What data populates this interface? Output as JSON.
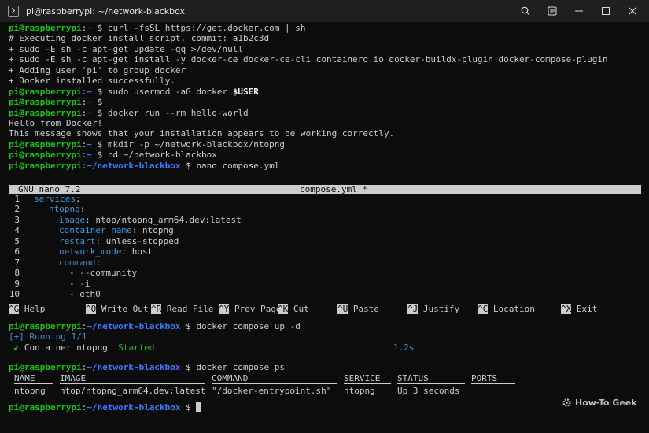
{
  "window": {
    "title": "pi@raspberrypi: ~/network-blackbox",
    "icons": [
      "terminal-icon",
      "search-icon",
      "tab-menu-icon",
      "minimize-icon",
      "maximize-icon",
      "close-icon"
    ]
  },
  "prompt": {
    "user": "pi@raspberrypi",
    "sep": ":",
    "home": "~",
    "project_path": "~/network-blackbox",
    "dollar": " $ "
  },
  "lines": {
    "l1_cmd": "curl -fsSL https://get.docker.com | sh",
    "l2": "# Executing docker install script, commit: a1b2c3d",
    "l3": "+ sudo -E sh -c apt-get update -qq >/dev/null",
    "l4": "+ sudo -E sh -c apt-get install -y docker-ce docker-ce-cli containerd.io docker-buildx-plugin docker-compose-plugin",
    "l5": "+ Adding user 'pi' to group docker",
    "l6": "+ Docker installed successfully.",
    "l7_cmd": "sudo usermod -aG docker ",
    "l7_var": "$USER",
    "l9_cmd": "docker run --rm hello-world",
    "l10": "Hello from Docker!",
    "l11": "This message shows that your installation appears to be working correctly.",
    "l12_cmd": "mkdir -p ~/network-blackbox/ntopng",
    "l13_cmd": "cd ~/network-blackbox",
    "l14_cmd": "nano compose.yml"
  },
  "nano": {
    "version": "GNU nano 7.2",
    "filename": "compose.yml *",
    "code": [
      {
        "n": "1",
        "key": "services",
        "rest": ":"
      },
      {
        "n": "2",
        "key": "ntopng",
        "rest": ":"
      },
      {
        "n": "3",
        "key": "image",
        "rest": ": ntop/ntopng_arm64.dev:latest"
      },
      {
        "n": "4",
        "key": "container_name",
        "rest": ": ntopng"
      },
      {
        "n": "5",
        "key": "restart",
        "rest": ": unless-stopped"
      },
      {
        "n": "6",
        "key": "network_mode",
        "rest": ": host"
      },
      {
        "n": "7",
        "key": "command",
        "rest": ":"
      },
      {
        "n": "8",
        "key": "",
        "rest": "- --community"
      },
      {
        "n": "9",
        "key": "",
        "rest": "- -i"
      },
      {
        "n": "10",
        "key": "",
        "rest": "- eth0"
      }
    ],
    "shortcuts": [
      {
        "key": "^G",
        "label": "Help"
      },
      {
        "key": "^O",
        "label": "Write Out"
      },
      {
        "key": "^R",
        "label": "Read File"
      },
      {
        "key": "^Y",
        "label": "Prev Page"
      },
      {
        "key": "^K",
        "label": "Cut"
      },
      {
        "key": "^U",
        "label": "Paste"
      },
      {
        "key": "^J",
        "label": "Justify"
      },
      {
        "key": "^C",
        "label": "Location"
      },
      {
        "key": "^X",
        "label": "Exit"
      }
    ]
  },
  "compose_up": {
    "cmd": "docker compose up -d",
    "running": "[+] Running 1/1",
    "check": "✔",
    "container_label": "Container ntopng",
    "status": "Started",
    "time": "1.2s"
  },
  "compose_ps": {
    "cmd": "docker compose ps",
    "headers": [
      "NAME",
      "IMAGE",
      "COMMAND",
      "SERVICE",
      "STATUS",
      "PORTS"
    ],
    "row": [
      "ntopng",
      "ntop/ntopng_arm64.dev:latest",
      "\"/docker-entrypoint.sh\"",
      "ntopng",
      "Up 3 seconds",
      ""
    ]
  },
  "watermark": "How-To Geek",
  "colors": {
    "prompt_user": "#16c60c",
    "prompt_path": "#3b78ff",
    "yaml_key": "#3a96dd",
    "bg": "#0c0c0c"
  }
}
